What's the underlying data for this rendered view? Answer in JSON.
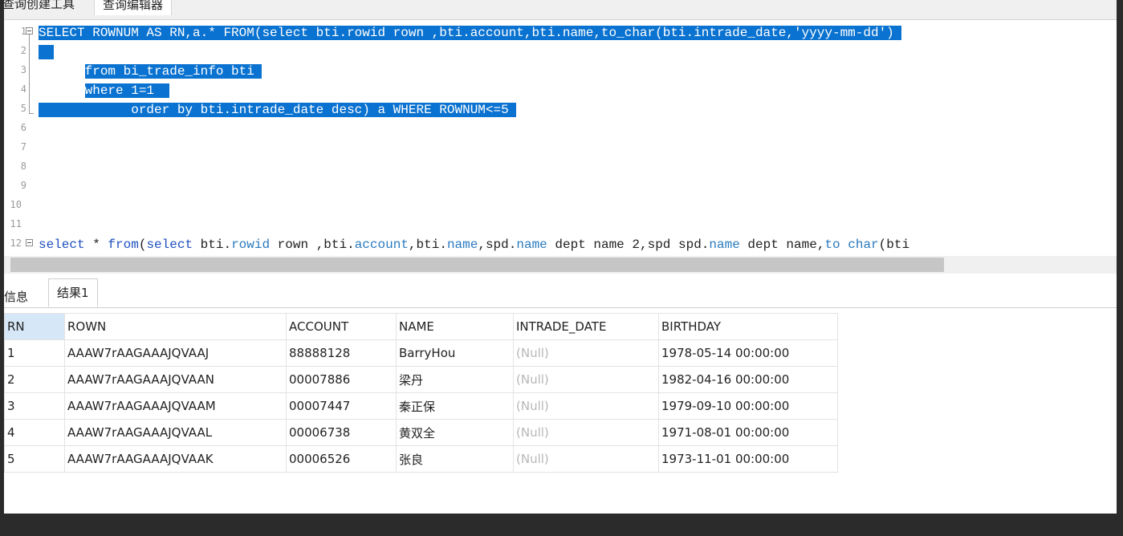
{
  "top_tabs": [
    "查询创建工具",
    "查询编辑器"
  ],
  "editor": {
    "lines": [
      {
        "num": "1",
        "segments": [
          {
            "text": "SELECT ROWNUM AS RN,a.* FROM(select bti.rowid rown ,bti.account,bti.name,to_char(bti.intrade_date,'yyyy-mm-dd') ",
            "cls": "sel"
          }
        ]
      },
      {
        "num": "2",
        "segments": [
          {
            "text": "  ",
            "cls": "sel"
          }
        ]
      },
      {
        "num": "3",
        "segments": [
          {
            "text": "      ",
            "cls": ""
          },
          {
            "text": "from bi_trade_info bti ",
            "cls": "sel"
          }
        ]
      },
      {
        "num": "4",
        "segments": [
          {
            "text": "      ",
            "cls": ""
          },
          {
            "text": "where 1=1  ",
            "cls": "sel"
          }
        ]
      },
      {
        "num": "5",
        "segments": [
          {
            "text": "            order by bti.intrade_date desc) a WHERE ROWNUM<=5 ",
            "cls": "sel"
          }
        ]
      },
      {
        "num": "6",
        "segments": []
      },
      {
        "num": "7",
        "segments": []
      },
      {
        "num": "8",
        "segments": []
      },
      {
        "num": "9",
        "segments": []
      },
      {
        "num": "10",
        "segments": []
      },
      {
        "num": "11",
        "segments": []
      },
      {
        "num": "12",
        "segments": [
          {
            "text": "select",
            "cls": "kw"
          },
          {
            "text": " * ",
            "cls": ""
          },
          {
            "text": "from",
            "cls": "kw"
          },
          {
            "text": "(",
            "cls": ""
          },
          {
            "text": "select",
            "cls": "kw"
          },
          {
            "text": " bti.",
            "cls": ""
          },
          {
            "text": "rowid",
            "cls": "fn"
          },
          {
            "text": " rown ,bti.",
            "cls": ""
          },
          {
            "text": "account",
            "cls": "fn"
          },
          {
            "text": ",bti.",
            "cls": ""
          },
          {
            "text": "name",
            "cls": "fn"
          },
          {
            "text": ",spd.",
            "cls": ""
          },
          {
            "text": "name",
            "cls": "fn"
          },
          {
            "text": " dept name 2,spd spd.",
            "cls": ""
          },
          {
            "text": "name",
            "cls": "fn"
          },
          {
            "text": " dept name,",
            "cls": ""
          },
          {
            "text": "to char",
            "cls": "fn"
          },
          {
            "text": "(bti",
            "cls": ""
          }
        ]
      }
    ]
  },
  "result_tabs": {
    "info": "信息",
    "result": "结果1"
  },
  "grid": {
    "columns": [
      "RN",
      "ROWN",
      "ACCOUNT",
      "NAME",
      "INTRADE_DATE",
      "BIRTHDAY"
    ],
    "rows": [
      [
        "1",
        "AAAW7rAAGAAAJQVAAJ",
        "88888128",
        "BarryHou",
        "(Null)",
        "1978-05-14 00:00:00"
      ],
      [
        "2",
        "AAAW7rAAGAAAJQVAAN",
        "00007886",
        "梁丹",
        "(Null)",
        "1982-04-16 00:00:00"
      ],
      [
        "3",
        "AAAW7rAAGAAAJQVAAM",
        "00007447",
        "秦正保",
        "(Null)",
        "1979-09-10 00:00:00"
      ],
      [
        "4",
        "AAAW7rAAGAAAJQVAAL",
        "00006738",
        "黄双全",
        "(Null)",
        "1971-08-01 00:00:00"
      ],
      [
        "5",
        "AAAW7rAAGAAAJQVAAK",
        "00006526",
        "张良",
        "(Null)",
        "1973-11-01 00:00:00"
      ]
    ]
  },
  "colors": {
    "selection": "#0a72d0",
    "keyword": "#1f4fbf",
    "null_text": "#b7b7b7",
    "rn_header": "#d6e8f7"
  }
}
